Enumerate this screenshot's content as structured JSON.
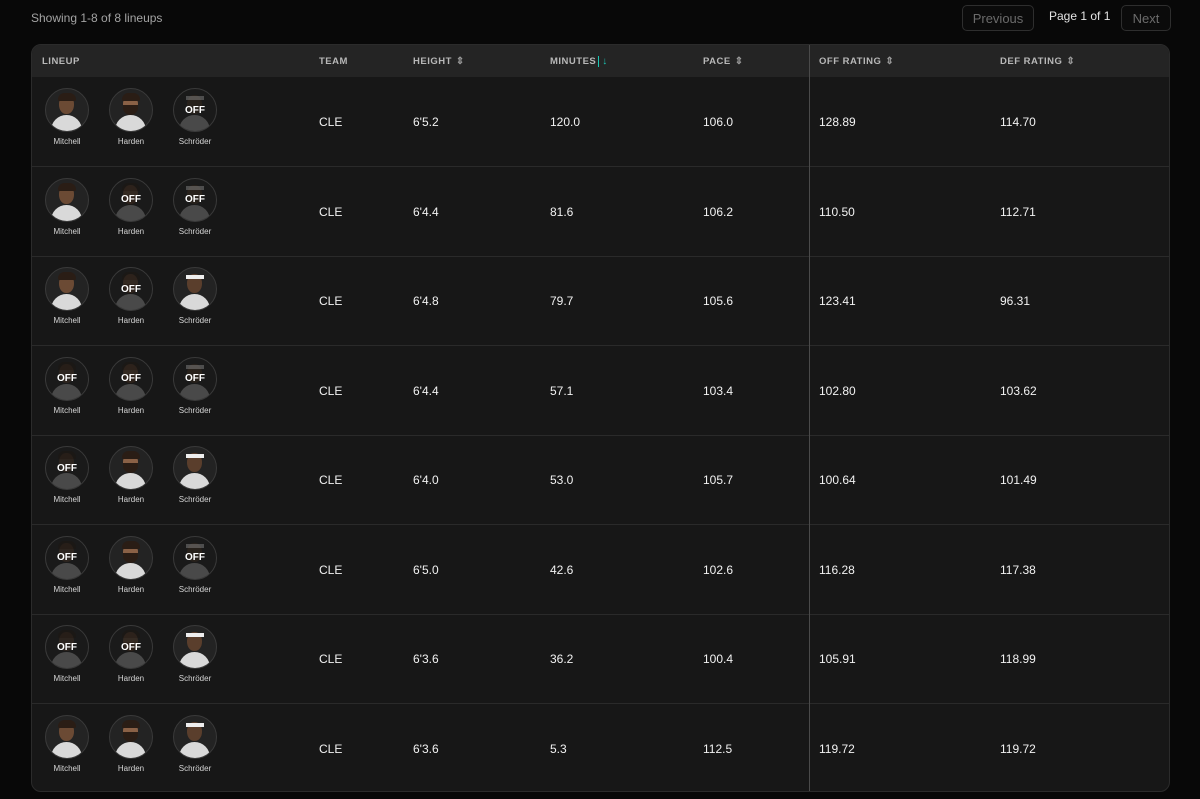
{
  "header": {
    "showing": "Showing 1-8 of 8 lineups",
    "previous_label": "Previous",
    "page_indicator": "Page 1 of 1",
    "next_label": "Next"
  },
  "columns": {
    "lineup": "LINEUP",
    "team": "TEAM",
    "height": "HEIGHT",
    "minutes": "MINUTES",
    "pace": "PACE",
    "off_rating": "OFF RATING",
    "def_rating": "DEF RATING",
    "sorted_by": "MINUTES",
    "sort_direction": "desc"
  },
  "off_label": "OFF",
  "accent_color": "#19c6b4",
  "rows": [
    {
      "players": [
        {
          "name": "Mitchell",
          "on": true
        },
        {
          "name": "Harden",
          "on": true
        },
        {
          "name": "Schröder",
          "on": false
        }
      ],
      "team": "CLE",
      "height": "6'5.2",
      "minutes": "120.0",
      "pace": "106.0",
      "off_rating": "128.89",
      "def_rating": "114.70"
    },
    {
      "players": [
        {
          "name": "Mitchell",
          "on": true
        },
        {
          "name": "Harden",
          "on": false
        },
        {
          "name": "Schröder",
          "on": false
        }
      ],
      "team": "CLE",
      "height": "6'4.4",
      "minutes": "81.6",
      "pace": "106.2",
      "off_rating": "110.50",
      "def_rating": "112.71"
    },
    {
      "players": [
        {
          "name": "Mitchell",
          "on": true
        },
        {
          "name": "Harden",
          "on": false
        },
        {
          "name": "Schröder",
          "on": true
        }
      ],
      "team": "CLE",
      "height": "6'4.8",
      "minutes": "79.7",
      "pace": "105.6",
      "off_rating": "123.41",
      "def_rating": "96.31"
    },
    {
      "players": [
        {
          "name": "Mitchell",
          "on": false
        },
        {
          "name": "Harden",
          "on": false
        },
        {
          "name": "Schröder",
          "on": false
        }
      ],
      "team": "CLE",
      "height": "6'4.4",
      "minutes": "57.1",
      "pace": "103.4",
      "off_rating": "102.80",
      "def_rating": "103.62"
    },
    {
      "players": [
        {
          "name": "Mitchell",
          "on": false
        },
        {
          "name": "Harden",
          "on": true
        },
        {
          "name": "Schröder",
          "on": true
        }
      ],
      "team": "CLE",
      "height": "6'4.0",
      "minutes": "53.0",
      "pace": "105.7",
      "off_rating": "100.64",
      "def_rating": "101.49"
    },
    {
      "players": [
        {
          "name": "Mitchell",
          "on": false
        },
        {
          "name": "Harden",
          "on": true
        },
        {
          "name": "Schröder",
          "on": false
        }
      ],
      "team": "CLE",
      "height": "6'5.0",
      "minutes": "42.6",
      "pace": "102.6",
      "off_rating": "116.28",
      "def_rating": "117.38"
    },
    {
      "players": [
        {
          "name": "Mitchell",
          "on": false
        },
        {
          "name": "Harden",
          "on": false
        },
        {
          "name": "Schröder",
          "on": true
        }
      ],
      "team": "CLE",
      "height": "6'3.6",
      "minutes": "36.2",
      "pace": "100.4",
      "off_rating": "105.91",
      "def_rating": "118.99"
    },
    {
      "players": [
        {
          "name": "Mitchell",
          "on": true
        },
        {
          "name": "Harden",
          "on": true
        },
        {
          "name": "Schröder",
          "on": true
        }
      ],
      "team": "CLE",
      "height": "6'3.6",
      "minutes": "5.3",
      "pace": "112.5",
      "off_rating": "119.72",
      "def_rating": "119.72"
    }
  ]
}
